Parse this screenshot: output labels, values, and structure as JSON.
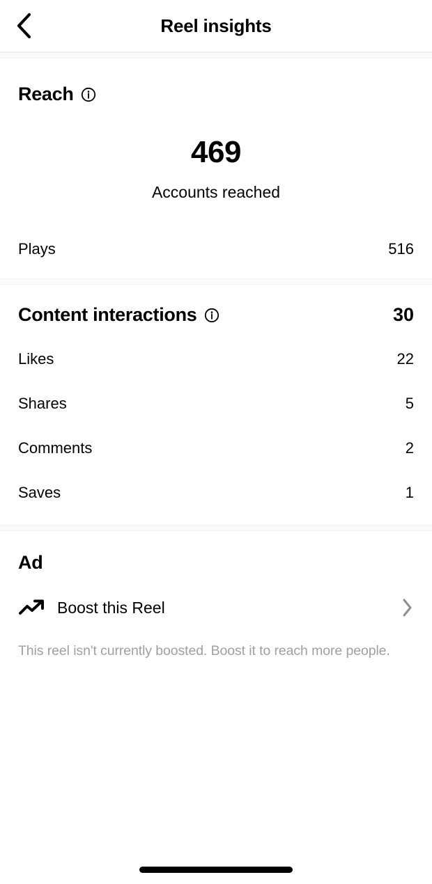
{
  "header": {
    "title": "Reel insights",
    "back_icon": "chevron-left-icon"
  },
  "reach": {
    "title": "Reach",
    "info_icon": "info-circle-icon",
    "big_value": "469",
    "big_label": "Accounts reached",
    "rows": [
      {
        "label": "Plays",
        "value": "516"
      }
    ]
  },
  "content_interactions": {
    "title": "Content interactions",
    "info_icon": "info-circle-icon",
    "total": "30",
    "rows": [
      {
        "label": "Likes",
        "value": "22"
      },
      {
        "label": "Shares",
        "value": "5"
      },
      {
        "label": "Comments",
        "value": "2"
      },
      {
        "label": "Saves",
        "value": "1"
      }
    ]
  },
  "ad": {
    "title": "Ad",
    "boost_icon": "trending-up-icon",
    "boost_label": "Boost this Reel",
    "chevron_icon": "chevron-right-icon",
    "caption": "This reel isn't currently boosted. Boost it to reach more people."
  },
  "colors": {
    "text": "#000000",
    "muted": "#a0a0a0",
    "separator": "#fafafa",
    "border": "#efefef"
  }
}
